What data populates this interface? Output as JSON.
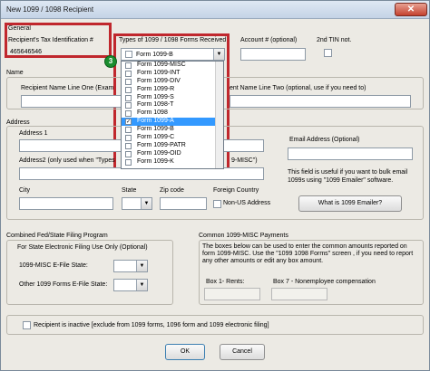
{
  "window": {
    "title": "New 1099 / 1098 Recipient",
    "close_glyph": "✕"
  },
  "general": {
    "group_label": "General",
    "tax_id_label": "Recipient's Tax Identification #",
    "tax_id_value": "465646546",
    "forms_label": "Types of 1099 / 1098 Forms Received",
    "forms_selected": "Form 1099-B",
    "account_label": "Account # (optional)",
    "second_tin_label": "2nd TIN not."
  },
  "forms_dropdown": {
    "badge": "3",
    "items": [
      {
        "label": "Form 1099-MISC",
        "checked": false,
        "selected": false
      },
      {
        "label": "Form 1099-INT",
        "checked": false,
        "selected": false
      },
      {
        "label": "Form 1099-DIV",
        "checked": false,
        "selected": false
      },
      {
        "label": "Form 1099-R",
        "checked": false,
        "selected": false
      },
      {
        "label": "Form 1099-S",
        "checked": false,
        "selected": false
      },
      {
        "label": "Form 1098-T",
        "checked": false,
        "selected": false
      },
      {
        "label": "Form 1098",
        "checked": false,
        "selected": false
      },
      {
        "label": "Form 1099-A",
        "checked": true,
        "selected": true
      },
      {
        "label": "Form 1099-B",
        "checked": false,
        "selected": false
      },
      {
        "label": "Form 1099-C",
        "checked": false,
        "selected": false
      },
      {
        "label": "Form 1099-PATR",
        "checked": false,
        "selected": false
      },
      {
        "label": "Form 1099-OID",
        "checked": false,
        "selected": false
      },
      {
        "label": "Form 1099-K",
        "checked": false,
        "selected": false
      }
    ]
  },
  "name": {
    "group_label": "Name",
    "line_one_label": "Recipient Name Line One (Exam",
    "line_two_label": "ent Name Line Two (optional, use if you need to)"
  },
  "address": {
    "group_label": "Address",
    "address1_label": "Address 1",
    "address2_label": "Address2 (only used when \"Types",
    "address2_suffix": "9-MISC\")",
    "city_label": "City",
    "state_label": "State",
    "zip_label": "Zip code",
    "foreign_label": "Foreign Country",
    "non_us_label": "Non-US Address",
    "email_label": "Email Address (Optional)",
    "email_help": "This field is useful if you want to bulk email 1099s using \"1099 Emailer\" software.",
    "emailer_button": "What is 1099 Emailer?"
  },
  "state_filing": {
    "group_label": "Combined Fed/State Filing Program",
    "subtitle": "For State Electronic Filing Use Only (Optional)",
    "misc_label": "1099-MISC E-File State:",
    "other_label": "Other 1099 Forms E-File State:"
  },
  "misc_payments": {
    "group_label": "Common 1099-MISC Payments",
    "description": "The boxes below can be used to enter the common amounts reported on form 1099-MISC. Use the \"1099 1098 Forms\" screen , if you need to report any other amounts or edit any box amount.",
    "box1_label": "Box 1- Rents:",
    "box7_label": "Box 7 - Nonemployee compensation"
  },
  "inactive": {
    "label": "Recipient is inactive [exclude from 1099 forms, 1096 form and 1099 electronic filing]"
  },
  "buttons": {
    "ok": "OK",
    "cancel": "Cancel"
  },
  "icons": {
    "dropdown_arrow": "▼",
    "check": "✓"
  },
  "colors": {
    "highlight_red": "#c0272d",
    "selection_blue": "#3399ff",
    "badge_green": "#1a8d2e"
  }
}
